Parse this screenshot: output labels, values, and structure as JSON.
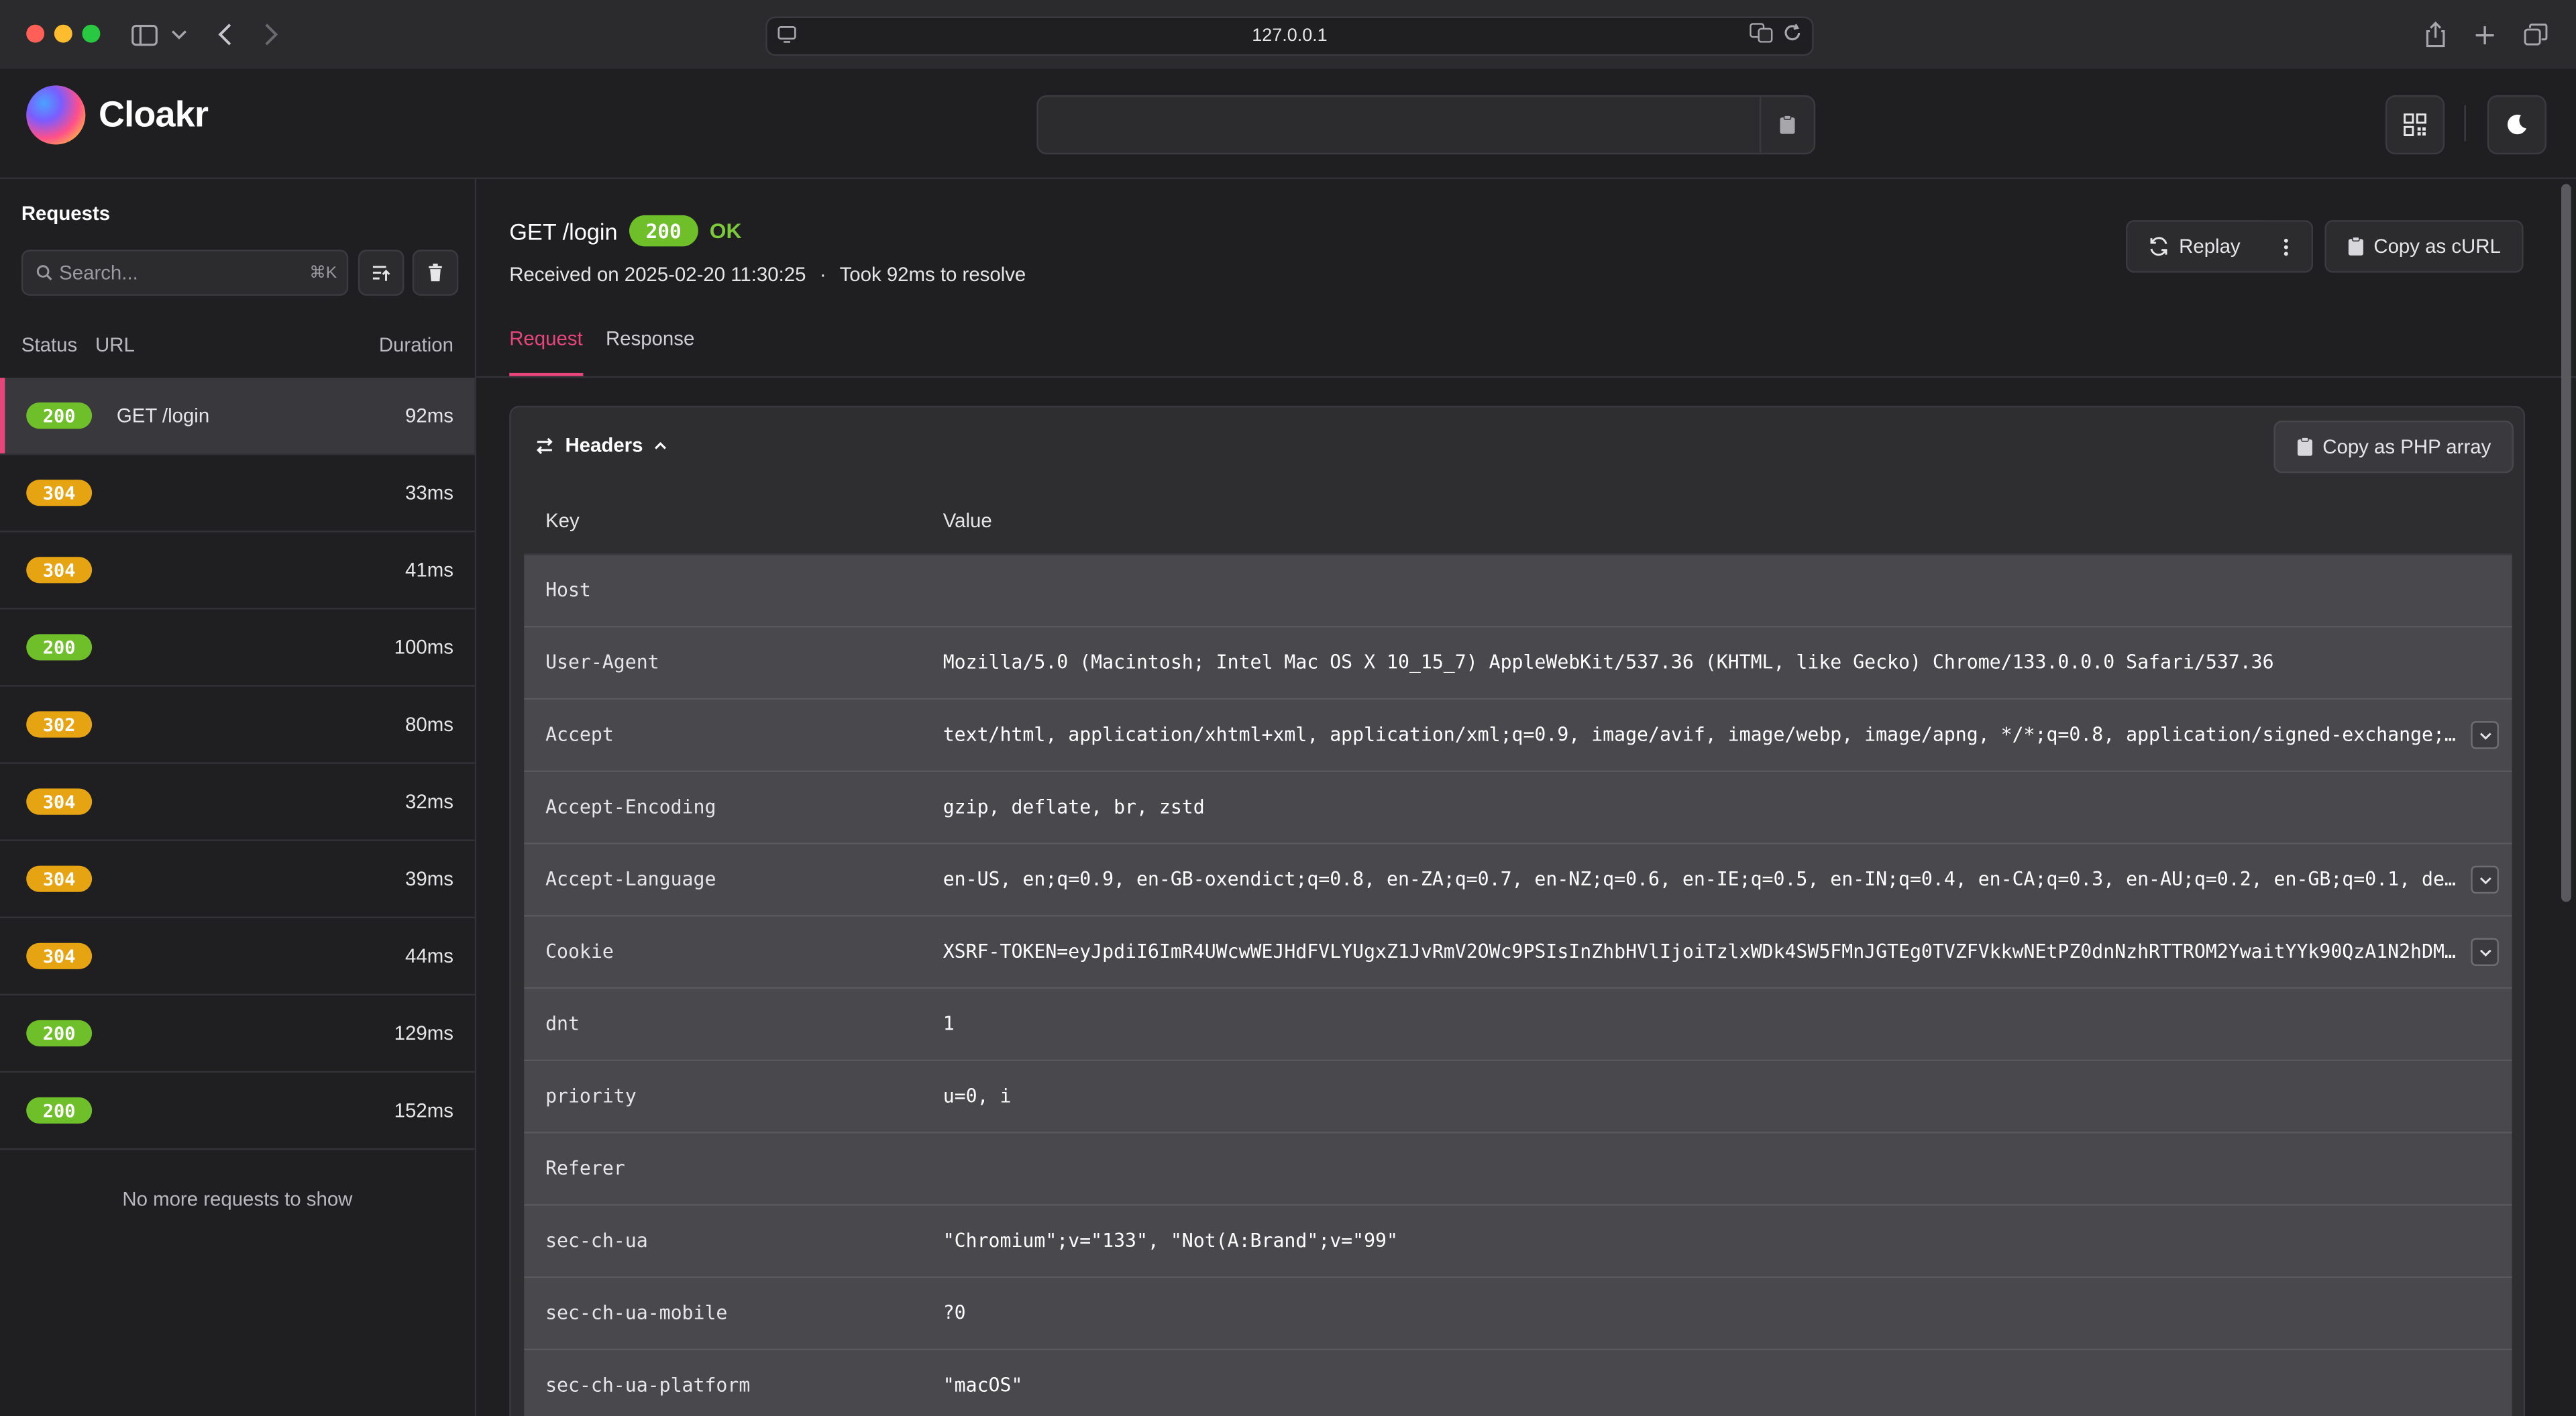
{
  "browser": {
    "url": "127.0.0.1"
  },
  "app": {
    "logo_text": "Cloakr"
  },
  "sidebar": {
    "title": "Requests",
    "search_placeholder": "Search...",
    "search_shortcut": "⌘K",
    "columns": {
      "status": "Status",
      "url": "URL",
      "duration": "Duration"
    },
    "requests": [
      {
        "status": "200",
        "url": "GET /login",
        "duration": "92ms",
        "active": true
      },
      {
        "status": "304",
        "url": "",
        "duration": "33ms"
      },
      {
        "status": "304",
        "url": "",
        "duration": "41ms"
      },
      {
        "status": "200",
        "url": "",
        "duration": "100ms"
      },
      {
        "status": "302",
        "url": "",
        "duration": "80ms"
      },
      {
        "status": "304",
        "url": "",
        "duration": "32ms"
      },
      {
        "status": "304",
        "url": "",
        "duration": "39ms"
      },
      {
        "status": "304",
        "url": "",
        "duration": "44ms"
      },
      {
        "status": "200",
        "url": "",
        "duration": "129ms"
      },
      {
        "status": "200",
        "url": "",
        "duration": "152ms"
      }
    ],
    "empty_text": "No more requests to show"
  },
  "detail": {
    "method_path": "GET /login",
    "status_code": "200",
    "status_text": "OK",
    "received": "Received on 2025-02-20 11:30:25",
    "took": "Took 92ms to resolve",
    "separator": "·",
    "replay_label": "Replay",
    "copy_curl_label": "Copy as cURL",
    "tabs": [
      "Request",
      "Response"
    ],
    "headers_title": "Headers",
    "copy_php_label": "Copy as PHP array",
    "table_key": "Key",
    "table_value": "Value",
    "headers": [
      {
        "key": "Host",
        "value": ""
      },
      {
        "key": "User-Agent",
        "value": "Mozilla/5.0 (Macintosh; Intel Mac OS X 10_15_7) AppleWebKit/537.36 (KHTML, like Gecko) Chrome/133.0.0.0 Safari/537.36"
      },
      {
        "key": "Accept",
        "value": "text/html, application/xhtml+xml, application/xml;q=0.9, image/avif, image/webp, image/apng, */*;q=0.8, application/signed-exchange;v…",
        "expandable": true
      },
      {
        "key": "Accept-Encoding",
        "value": "gzip, deflate, br, zstd"
      },
      {
        "key": "Accept-Language",
        "value": "en-US, en;q=0.9, en-GB-oxendict;q=0.8, en-ZA;q=0.7, en-NZ;q=0.6, en-IE;q=0.5, en-IN;q=0.4, en-CA;q=0.3, en-AU;q=0.2, en-GB;q=0.1, de;…",
        "expandable": true
      },
      {
        "key": "Cookie",
        "value": "XSRF-TOKEN=eyJpdiI6ImR4UWcwWEJHdFVLYUgxZ1JvRmV2OWc9PSIsInZhbHVlIjoiTzlxWDk4SW5FMnJGTEg0TVZFVkkwNEtPZ0dnNzhRTTROM2YwaitYYk90QzA1N2hDMk…",
        "expandable": true
      },
      {
        "key": "dnt",
        "value": "1"
      },
      {
        "key": "priority",
        "value": "u=0, i"
      },
      {
        "key": "Referer",
        "value": ""
      },
      {
        "key": "sec-ch-ua",
        "value": "\"Chromium\";v=\"133\", \"Not(A:Brand\";v=\"99\""
      },
      {
        "key": "sec-ch-ua-mobile",
        "value": "?0"
      },
      {
        "key": "sec-ch-ua-platform",
        "value": "\"macOS\""
      }
    ]
  },
  "colors": {
    "accent": "#e8457a",
    "status_ok": "#6fbf2b",
    "status_warn": "#e7a412"
  }
}
